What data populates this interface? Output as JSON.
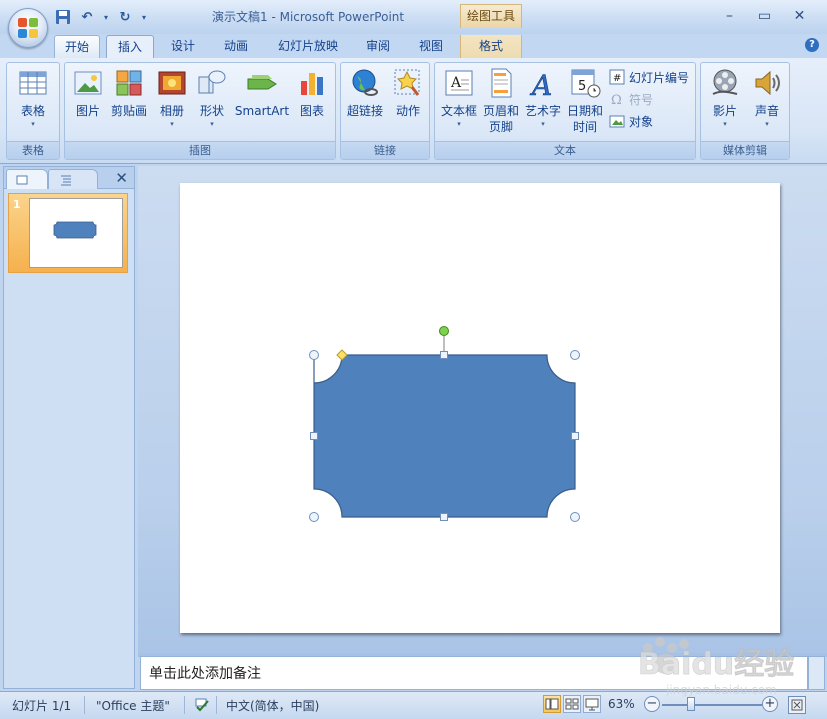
{
  "window": {
    "title": "演示文稿1 - Microsoft PowerPoint",
    "context_tab_header": "绘图工具",
    "minimize": "–",
    "maximize": "▭",
    "close": "✕"
  },
  "qat": {
    "save": "save-icon",
    "undo": "↶",
    "undo_dd": "▾",
    "redo": "↻",
    "customize": "▾"
  },
  "tabs": [
    {
      "label": "开始"
    },
    {
      "label": "插入"
    },
    {
      "label": "设计"
    },
    {
      "label": "动画"
    },
    {
      "label": "幻灯片放映"
    },
    {
      "label": "审阅"
    },
    {
      "label": "视图"
    },
    {
      "label": "格式"
    }
  ],
  "active_tab": "插入",
  "help": "?",
  "ribbon": {
    "groups": {
      "tables": "表格",
      "illustrations": "插图",
      "links": "链接",
      "text": "文本",
      "media": "媒体剪辑"
    },
    "buttons": {
      "table": "表格",
      "picture": "图片",
      "clipart": "剪贴画",
      "album": "相册",
      "shapes": "形状",
      "smartart": "SmartArt",
      "chart": "图表",
      "hyperlink": "超链接",
      "action": "动作",
      "textbox": "文本框",
      "header_footer_1": "页眉和",
      "header_footer_2": "页脚",
      "wordart": "艺术字",
      "datetime_1": "日期和",
      "datetime_2": "时间",
      "slide_number": "幻灯片编号",
      "symbol": "符号",
      "object": "对象",
      "movie": "影片",
      "sound": "声音",
      "dropdown": "▾"
    }
  },
  "slides_pane": {
    "close": "✕",
    "slide_number": "1"
  },
  "notes": {
    "placeholder": "单击此处添加备注"
  },
  "status": {
    "slide": "幻灯片 1/1",
    "theme": "\"Office 主题\"",
    "language": "中文(简体，中国)",
    "zoom": "63%",
    "zoom_level": 0.63,
    "zoom_minus": "−",
    "zoom_plus": "+"
  },
  "watermark": {
    "text": "Baidu经验",
    "url": "jingyan.baidu.com"
  },
  "colors": {
    "shape_fill": "#4f81bd",
    "shape_stroke": "#385d8a",
    "rotate_handle": "#7fd04a",
    "adjust_handle": "#ffe066",
    "thumb_highlight": "#f5b14d"
  }
}
